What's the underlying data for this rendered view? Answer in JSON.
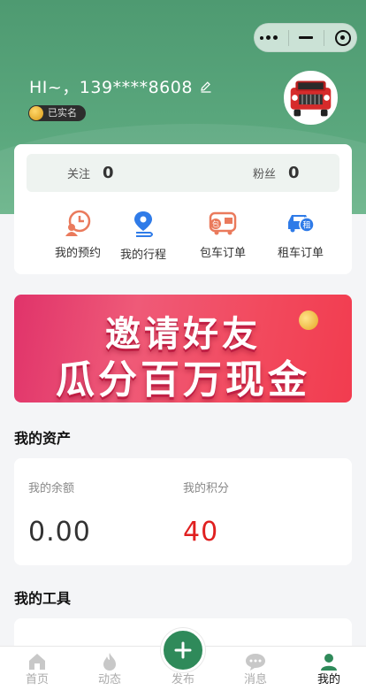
{
  "header": {
    "greeting": "HI~，139****8608",
    "verified_label": "已实名"
  },
  "social": {
    "following_label": "关注",
    "following_count": "0",
    "fans_label": "粉丝",
    "fans_count": "0"
  },
  "quick_actions": [
    {
      "label": "我的预约",
      "icon": "appointment-clock-icon"
    },
    {
      "label": "我的行程",
      "icon": "location-route-icon"
    },
    {
      "label": "包车订单",
      "icon": "charter-bus-icon"
    },
    {
      "label": "租车订单",
      "icon": "rental-car-icon"
    }
  ],
  "banner": {
    "line1": "邀请好友",
    "line2": "瓜分百万现金"
  },
  "assets": {
    "title": "我的资产",
    "balance_label": "我的余额",
    "balance_value": "0.00",
    "points_label": "我的积分",
    "points_value": "40"
  },
  "tools": {
    "title": "我的工具"
  },
  "tabbar": {
    "items": [
      {
        "label": "首页",
        "icon": "home-icon"
      },
      {
        "label": "动态",
        "icon": "flame-icon"
      },
      {
        "label": "发布",
        "icon": "plus-icon"
      },
      {
        "label": "消息",
        "icon": "chat-bubble-icon"
      },
      {
        "label": "我的",
        "icon": "person-icon"
      }
    ],
    "active": "我的"
  },
  "colors": {
    "brand_green": "#4e9a71",
    "points_red": "#e02020",
    "publish_green": "#2f8a5a"
  }
}
